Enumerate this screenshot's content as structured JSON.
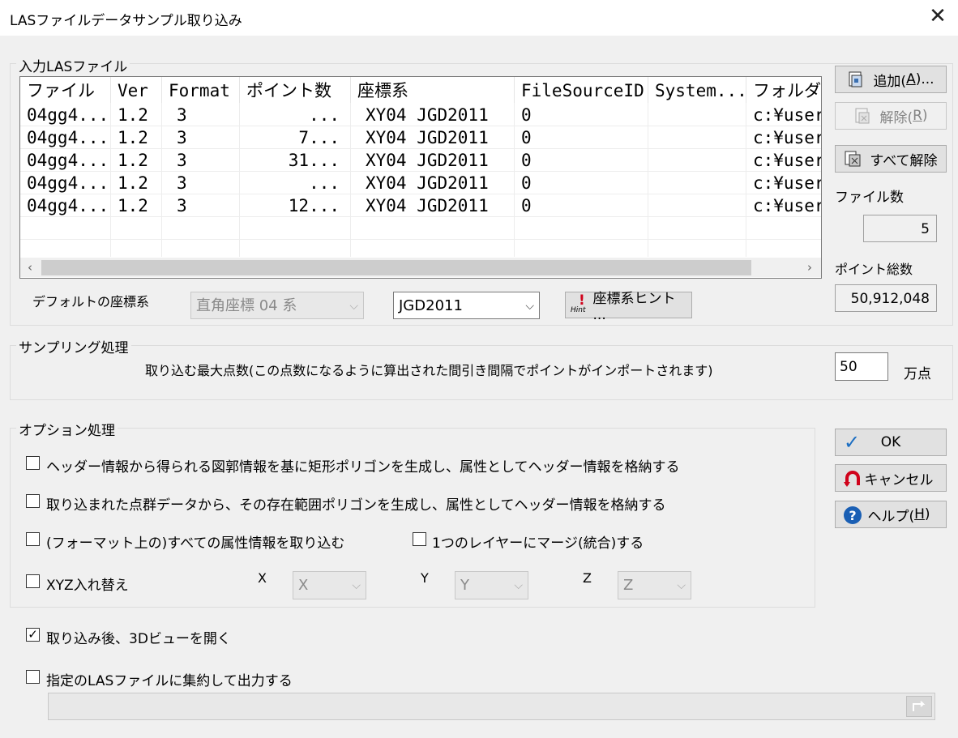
{
  "window": {
    "title": "LASファイルデータサンプル取り込み",
    "close_glyph": "✕"
  },
  "input_group": {
    "legend": "入力LASファイル",
    "columns": [
      "ファイル",
      "Ver",
      "Format",
      "ポイント数",
      "座標系",
      "FileSourceID",
      "System...",
      "フォルダ"
    ],
    "rows": [
      [
        "04gg4...",
        "1.2",
        "3",
        "...",
        "XY04 JGD2011",
        "0",
        "",
        "c:¥user"
      ],
      [
        "04gg4...",
        "1.2",
        "3",
        "7...",
        "XY04 JGD2011",
        "0",
        "",
        "c:¥user"
      ],
      [
        "04gg4...",
        "1.2",
        "3",
        "31...",
        "XY04 JGD2011",
        "0",
        "",
        "c:¥user"
      ],
      [
        "04gg4...",
        "1.2",
        "3",
        "...",
        "XY04 JGD2011",
        "0",
        "",
        "c:¥user"
      ],
      [
        "04gg4...",
        "1.2",
        "3",
        "12...",
        "XY04 JGD2011",
        "0",
        "",
        "c:¥user"
      ]
    ],
    "default_crs_label": "デフォルトの座標系",
    "crs_select": "直角座標 04 系",
    "datum_select": "JGD2011",
    "hint_button": "座標系ヒント ...",
    "hint_icon_text": "Hint"
  },
  "side": {
    "add_button": {
      "label": "追加(",
      "key": "A",
      "suffix": ")..."
    },
    "remove_button": {
      "label": "解除(",
      "key": "R",
      "suffix": ")"
    },
    "remove_all_button": "すべて解除",
    "file_count_label": "ファイル数",
    "file_count": "5",
    "point_total_label": "ポイント総数",
    "point_total": "50,912,048"
  },
  "sampling": {
    "legend": "サンプリング処理",
    "description": "取り込む最大点数(この点数になるように算出された間引き間隔でポイントがインポートされます)",
    "max_points": "50",
    "unit": "万点"
  },
  "options": {
    "legend": "オプション処理",
    "opt1": "ヘッダー情報から得られる図郭情報を基に矩形ポリゴンを生成し、属性としてヘッダー情報を格納する",
    "opt2": "取り込まれた点群データから、その存在範囲ポリゴンを生成し、属性としてヘッダー情報を格納する",
    "opt3": "(フォーマット上の)すべての属性情報を取り込む",
    "opt4": "1つのレイヤーにマージ(統合)する",
    "opt5": "XYZ入れ替え",
    "x_label": "X",
    "x_value": "X",
    "y_label": "Y",
    "y_value": "Y",
    "z_label": "Z",
    "z_value": "Z"
  },
  "bottom": {
    "open_3d": "取り込み後、3Dビューを開く",
    "open_3d_checked": true,
    "merge_output": "指定のLASファイルに集約して出力する",
    "merge_output_path": ""
  },
  "actions": {
    "ok": "OK",
    "cancel": "キャンセル",
    "help": {
      "label": "ヘルプ(",
      "key": "H",
      "suffix": ")"
    }
  },
  "colors": {
    "accent_ok": "#1b6ec2",
    "cancel_red": "#d0021b",
    "help_blue": "#1a5fb4"
  }
}
